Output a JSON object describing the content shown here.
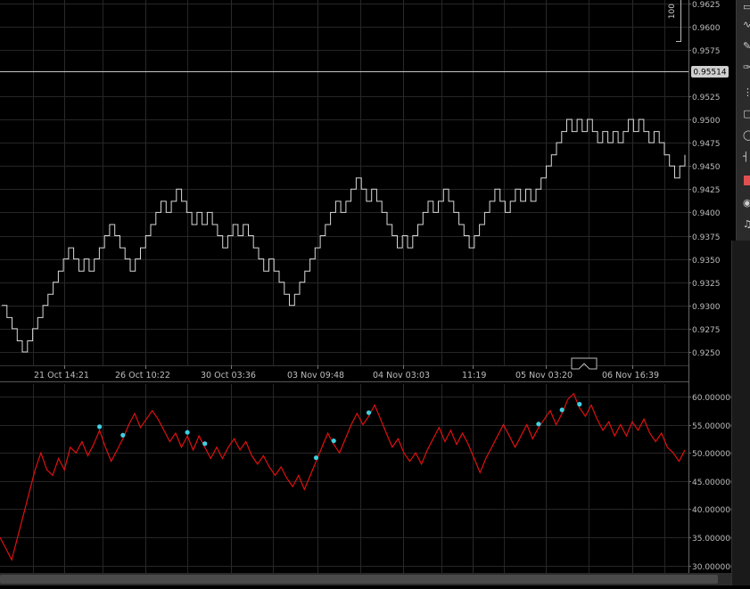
{
  "chart_data": [
    {
      "type": "line",
      "style": "renko-steps",
      "title": "",
      "xlabel": "",
      "ylabel": "",
      "ylim": [
        0.9235,
        0.9632
      ],
      "y_ticks": [
        "0.9625",
        "0.9600",
        "0.9575",
        "0.9525",
        "0.9500",
        "0.9475",
        "0.9450",
        "0.9425",
        "0.9400",
        "0.9375",
        "0.9350",
        "0.9325",
        "0.9300",
        "0.9275",
        "0.9250"
      ],
      "y_tick_values": [
        0.9625,
        0.96,
        0.9575,
        0.9525,
        0.95,
        0.9475,
        0.945,
        0.9425,
        0.94,
        0.9375,
        0.935,
        0.9325,
        0.93,
        0.9275,
        0.925
      ],
      "current_price": 0.95514,
      "current_price_label": "0.95514",
      "x_ticks": [
        "21 Oct 14:21",
        "26 Oct 10:22",
        "30 Oct 03:36",
        "03 Nov 09:48",
        "04 Nov 03:03",
        "11:19",
        "05 Nov 03:20",
        "06 Nov 16:39"
      ],
      "grid": true,
      "scale_label": "100",
      "series": [
        {
          "color": "#d8d8d8",
          "values": [
            0.93,
            0.9287,
            0.9275,
            0.9262,
            0.925,
            0.9262,
            0.9275,
            0.9287,
            0.93,
            0.9312,
            0.9325,
            0.9337,
            0.935,
            0.9362,
            0.935,
            0.9337,
            0.935,
            0.9337,
            0.935,
            0.9362,
            0.9375,
            0.9387,
            0.9375,
            0.9362,
            0.935,
            0.9337,
            0.935,
            0.9362,
            0.9375,
            0.9387,
            0.94,
            0.9412,
            0.94,
            0.9412,
            0.9425,
            0.9412,
            0.94,
            0.9387,
            0.94,
            0.9387,
            0.94,
            0.9387,
            0.9375,
            0.9362,
            0.9375,
            0.9387,
            0.9375,
            0.9387,
            0.9375,
            0.9362,
            0.935,
            0.9337,
            0.935,
            0.9337,
            0.9325,
            0.9312,
            0.93,
            0.9312,
            0.9325,
            0.9337,
            0.935,
            0.9362,
            0.9375,
            0.9387,
            0.94,
            0.9412,
            0.94,
            0.9412,
            0.9425,
            0.9437,
            0.9425,
            0.9412,
            0.9425,
            0.9412,
            0.94,
            0.9387,
            0.9375,
            0.9362,
            0.9375,
            0.9362,
            0.9375,
            0.9387,
            0.94,
            0.9412,
            0.94,
            0.9412,
            0.9425,
            0.9412,
            0.94,
            0.9387,
            0.9375,
            0.9362,
            0.9375,
            0.9387,
            0.94,
            0.9412,
            0.9425,
            0.9412,
            0.94,
            0.9412,
            0.9425,
            0.9412,
            0.9425,
            0.9412,
            0.9425,
            0.9437,
            0.945,
            0.9462,
            0.9475,
            0.9487,
            0.95,
            0.9487,
            0.95,
            0.9487,
            0.95,
            0.9487,
            0.9475,
            0.9487,
            0.9475,
            0.9487,
            0.9475,
            0.9487,
            0.95,
            0.9487,
            0.95,
            0.9487,
            0.9475,
            0.9487,
            0.9475,
            0.9462,
            0.945,
            0.9437,
            0.945,
            0.9462
          ]
        }
      ]
    },
    {
      "type": "line",
      "title": "",
      "xlabel": "",
      "ylabel": "",
      "ylim": [
        29.5,
        62.5
      ],
      "y_ticks": [
        "60.000000",
        "55.000000",
        "50.000000",
        "45.000000",
        "40.000000",
        "35.000000",
        "30.000000"
      ],
      "y_tick_values": [
        60,
        55,
        50,
        45,
        40,
        35,
        30
      ],
      "grid": true,
      "marker_color": "#3fd0e0",
      "series": [
        {
          "color": "#e01010",
          "values": [
            35.0,
            33.0,
            31.0,
            35.0,
            39.0,
            43.0,
            47.0,
            50.0,
            47.0,
            46.0,
            49.0,
            47.0,
            51.0,
            50.0,
            52.0,
            49.5,
            51.5,
            54.0,
            51.0,
            48.5,
            50.5,
            52.5,
            55.0,
            57.0,
            54.5,
            56.0,
            57.5,
            56.0,
            54.0,
            52.0,
            53.5,
            51.0,
            53.0,
            50.5,
            53.0,
            51.0,
            49.0,
            51.0,
            49.0,
            51.0,
            52.5,
            50.5,
            52.0,
            49.5,
            48.0,
            49.5,
            47.5,
            46.0,
            47.5,
            45.5,
            44.0,
            46.0,
            43.5,
            46.0,
            48.5,
            51.0,
            53.5,
            51.5,
            50.0,
            52.5,
            55.0,
            57.0,
            55.0,
            56.5,
            58.5,
            56.0,
            53.5,
            51.0,
            52.5,
            50.0,
            48.5,
            50.0,
            48.0,
            50.5,
            52.5,
            54.5,
            52.0,
            54.0,
            51.5,
            53.5,
            51.5,
            49.0,
            46.5,
            49.0,
            51.0,
            53.0,
            55.0,
            53.0,
            51.0,
            53.0,
            55.0,
            52.5,
            54.5,
            56.0,
            57.5,
            55.0,
            57.0,
            59.5,
            60.5,
            58.0,
            56.5,
            58.5,
            56.0,
            54.0,
            55.5,
            53.0,
            55.0,
            53.0,
            55.5,
            54.0,
            56.0,
            53.5,
            52.0,
            53.5,
            51.0,
            50.0,
            48.5,
            50.5
          ]
        }
      ],
      "highlight_points": [
        17,
        21,
        32,
        35,
        54,
        57,
        63,
        92,
        96,
        99
      ]
    }
  ]
}
